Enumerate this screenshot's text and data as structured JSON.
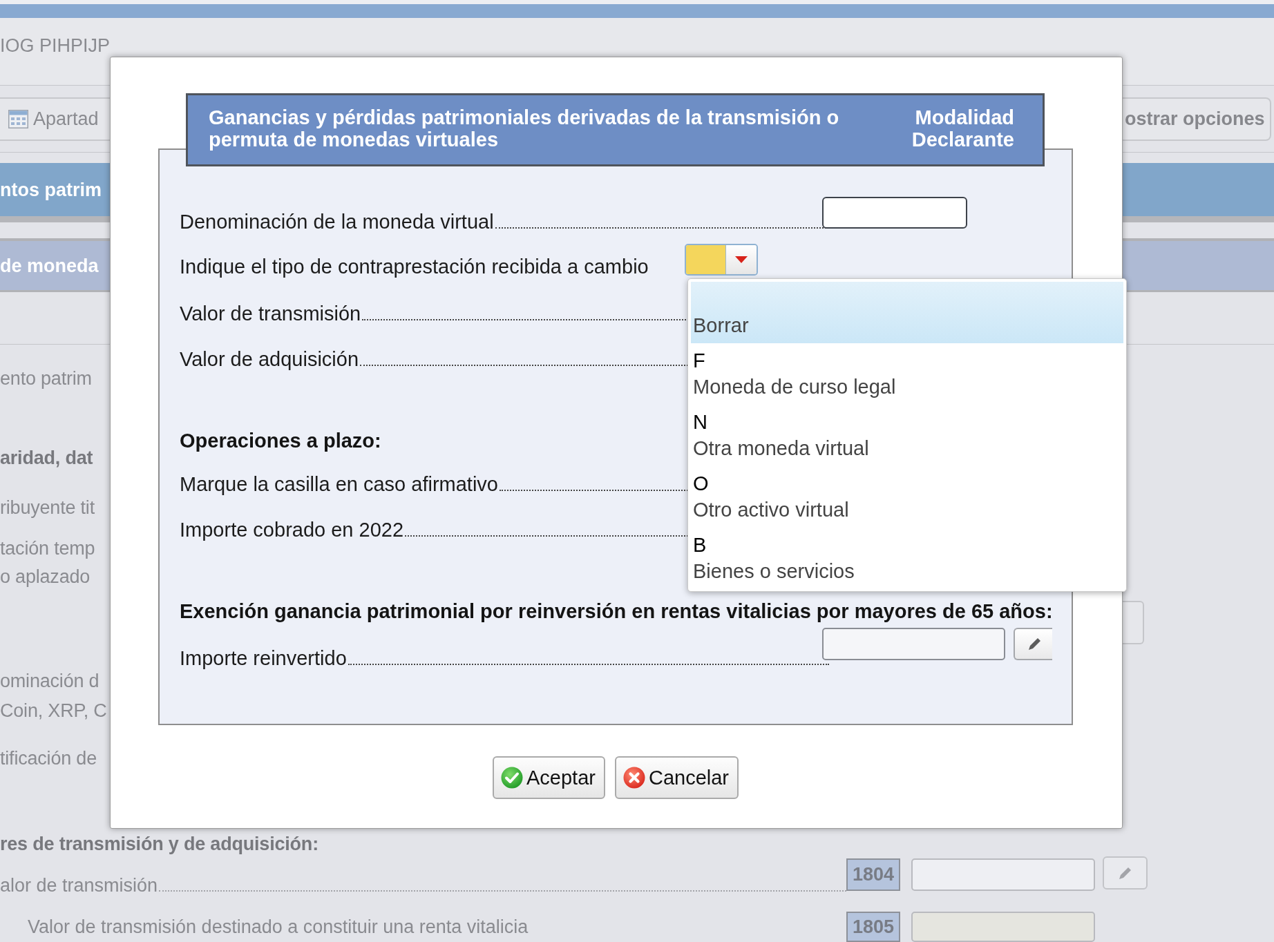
{
  "page": {
    "top_label": "IOG PIHPIJP",
    "toolbar": {
      "left_button": "Apartad",
      "right_button": "ostrar opciones"
    },
    "section_bar": "ntos patrim",
    "subsection_bar": "de moneda",
    "lines": [
      {
        "kind": "text",
        "text": "ento patrim"
      },
      {
        "kind": "bold",
        "text": "aridad, dat"
      },
      {
        "kind": "text",
        "text": "ribuyente tit"
      },
      {
        "kind": "text",
        "text": "tación temp"
      },
      {
        "kind": "text",
        "text": "o aplazado"
      },
      {
        "kind": "button_edge"
      },
      {
        "kind": "text",
        "text": "ominación d"
      },
      {
        "kind": "text",
        "text": "Coin, XRP, C"
      },
      {
        "kind": "text",
        "text": "tificación de"
      },
      {
        "kind": "bold",
        "text": "res de transmisión y de adquisición:"
      }
    ],
    "boxes": [
      {
        "kind": "leader",
        "label": "alor de transmisión",
        "code": "1804",
        "disabled": false
      },
      {
        "kind": "indented",
        "label": "Valor de transmisión destinado a constituir una renta vitalicia",
        "code": "1805",
        "disabled": true
      }
    ]
  },
  "dialog": {
    "title": "Ganancias y pérdidas patrimoniales derivadas de la transmisión o permuta de monedas virtuales",
    "modality_label": "Modalidad",
    "modality_value": "Declarante",
    "rows": [
      {
        "kind": "input",
        "label": "Denominación de la moneda virtual"
      },
      {
        "kind": "select",
        "label": "Indique el tipo de contraprestación recibida a cambio",
        "expanded": true,
        "options": [
          {
            "label": "Borrar",
            "selected": true
          },
          {
            "code": "F",
            "label": "Moneda de curso legal",
            "selected": false
          },
          {
            "code": "N",
            "label": "Otra moneda virtual",
            "selected": false
          },
          {
            "code": "O",
            "label": "Otro activo virtual",
            "selected": false
          },
          {
            "code": "B",
            "label": "Bienes o servicios",
            "selected": false
          }
        ]
      },
      {
        "kind": "leader",
        "label": "Valor de transmisión"
      },
      {
        "kind": "leader",
        "label": "Valor de adquisición"
      },
      {
        "kind": "heading",
        "label": "Operaciones a plazo:"
      },
      {
        "kind": "leader",
        "label": "Marque la casilla en caso afirmativo"
      },
      {
        "kind": "leader",
        "label": "Importe cobrado en 2022"
      },
      {
        "kind": "heading",
        "label": "Exención ganancia patrimonial por reinversión en rentas vitalicias por mayores de 65 años:"
      },
      {
        "kind": "amount",
        "label": "Importe reinvertido"
      }
    ],
    "buttons": [
      {
        "kind": "accept",
        "label": "Aceptar"
      },
      {
        "kind": "cancel",
        "label": "Cancelar"
      }
    ]
  }
}
